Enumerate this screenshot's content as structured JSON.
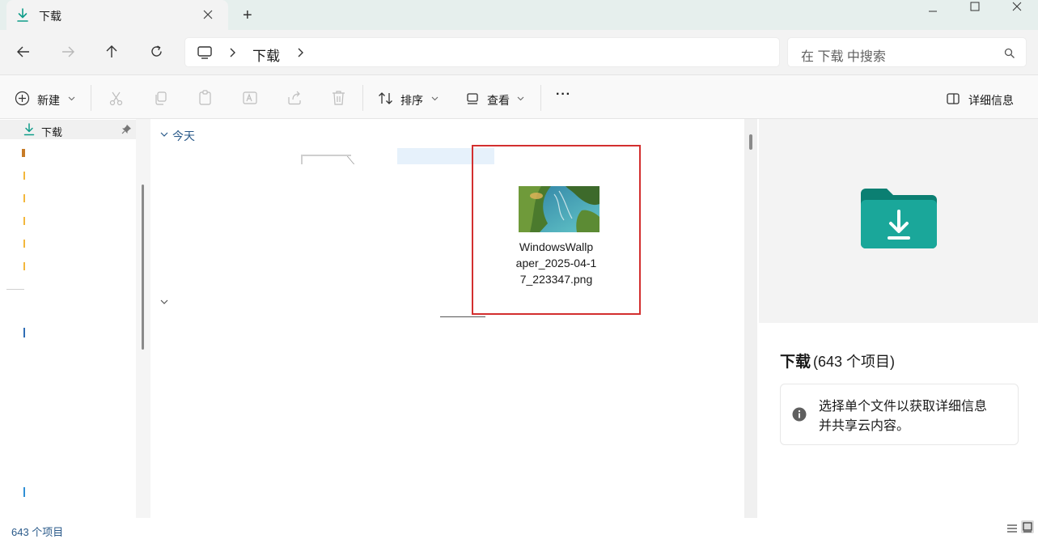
{
  "tab": {
    "title": "下载",
    "new_tab_label": "+"
  },
  "address": {
    "crumbs": [
      "下载"
    ]
  },
  "search": {
    "placeholder": "在 下载 中搜索"
  },
  "commands": {
    "new_label": "新建",
    "sort_label": "排序",
    "view_label": "查看",
    "more_label": "···",
    "details_label": "详细信息"
  },
  "nav": {
    "pinned_item": "下载"
  },
  "content": {
    "group_today": "今天",
    "file": {
      "name_line1": "WindowsWallp",
      "name_line2": "aper_2025-04-1",
      "name_line3": "7_223347.png"
    }
  },
  "details": {
    "folder_name": "下载",
    "folder_count": "(643 个项目)",
    "hint_line1": "选择单个文件以获取详细信息",
    "hint_line2": "并共享云内容。"
  },
  "status": {
    "count": "643 个项目"
  },
  "colors": {
    "accent": "#0f9d8a",
    "highlight_box": "#d32f2f",
    "selection": "#e6f1fb"
  }
}
